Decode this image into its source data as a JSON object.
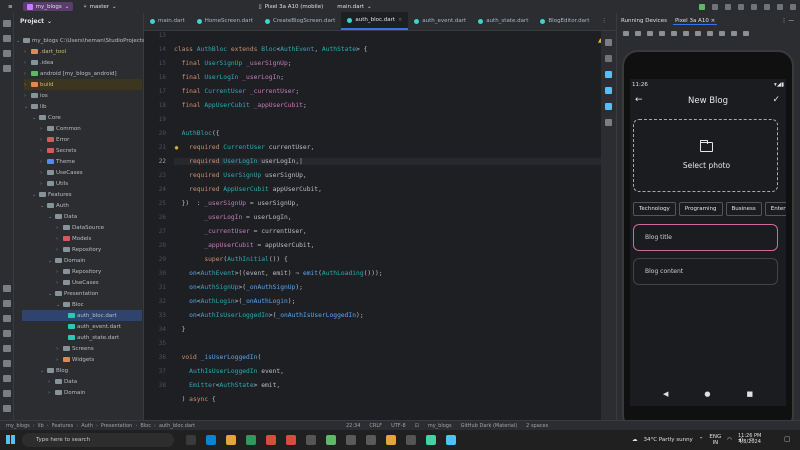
{
  "titlebar": {
    "project": "my_blogs",
    "branch": "master",
    "run_config": "main.dart",
    "device": "Pixel 3a A10 (mobile)"
  },
  "project_panel": {
    "title": "Project",
    "tree": [
      {
        "label": "my_blogs  C:\\Users\\heman\\StudioProjects",
        "kind": "root"
      },
      {
        "label": ".dart_tool",
        "kind": "ylw"
      },
      {
        "label": ".idea",
        "kind": "n"
      },
      {
        "label": "android [my_blogs_android]",
        "kind": "n"
      },
      {
        "label": "build",
        "kind": "ylw"
      },
      {
        "label": "ios",
        "kind": "n"
      },
      {
        "label": "lib",
        "kind": "n"
      },
      {
        "label": "Core",
        "kind": "n"
      },
      {
        "label": "Common",
        "kind": "n"
      },
      {
        "label": "Error",
        "kind": "n"
      },
      {
        "label": "Secrets",
        "kind": "n"
      },
      {
        "label": "Theme",
        "kind": "n"
      },
      {
        "label": "UseCases",
        "kind": "n"
      },
      {
        "label": "Utils",
        "kind": "n"
      },
      {
        "label": "Features",
        "kind": "n"
      },
      {
        "label": "Auth",
        "kind": "n"
      },
      {
        "label": "Data",
        "kind": "n"
      },
      {
        "label": "DataSource",
        "kind": "n"
      },
      {
        "label": "Models",
        "kind": "n"
      },
      {
        "label": "Repository",
        "kind": "n"
      },
      {
        "label": "Domain",
        "kind": "n"
      },
      {
        "label": "Repository",
        "kind": "n"
      },
      {
        "label": "UseCases",
        "kind": "n"
      },
      {
        "label": "Presentation",
        "kind": "n"
      },
      {
        "label": "Bloc",
        "kind": "n"
      },
      {
        "label": "auth_bloc.dart",
        "kind": "file"
      },
      {
        "label": "auth_event.dart",
        "kind": "file"
      },
      {
        "label": "auth_state.dart",
        "kind": "file"
      },
      {
        "label": "Screens",
        "kind": "n"
      },
      {
        "label": "Widgets",
        "kind": "n"
      },
      {
        "label": "Blog",
        "kind": "n"
      },
      {
        "label": "Data",
        "kind": "n"
      },
      {
        "label": "Domain",
        "kind": "n"
      }
    ]
  },
  "tabs": [
    {
      "label": "main.dart",
      "active": false
    },
    {
      "label": "HomeScreen.dart",
      "active": false
    },
    {
      "label": "CreateBlogScreen.dart",
      "active": false
    },
    {
      "label": "auth_bloc.dart",
      "active": true
    },
    {
      "label": "auth_event.dart",
      "active": false
    },
    {
      "label": "auth_state.dart",
      "active": false
    },
    {
      "label": "BlogEditor.dart",
      "active": false
    }
  ],
  "editor": {
    "warning": "▲3",
    "line_numbers": [
      "13",
      "14",
      "15",
      "16",
      "17",
      "18",
      "19",
      "20",
      "21",
      "22",
      "23",
      "24",
      "25",
      "26",
      "27",
      "28",
      "29",
      "30",
      "31",
      "32",
      "33",
      "34",
      "35",
      "36",
      "37",
      "38"
    ],
    "current_line": "22"
  },
  "running_devices": {
    "title": "Running Devices",
    "tab": "Pixel 3a A10"
  },
  "phone": {
    "time": "11:26",
    "title": "New Blog",
    "select_photo": "Select photo",
    "chips": [
      "Technology",
      "Programing",
      "Business",
      "Entert"
    ],
    "blog_title_hint": "Blog title",
    "blog_content_hint": "Blog content"
  },
  "breadcrumb": [
    "my_blogs",
    "lib",
    "Features",
    "Auth",
    "Presentation",
    "Bloc",
    "auth_bloc.dart"
  ],
  "statusbar": {
    "position": "22:34",
    "line_sep": "CRLF",
    "encoding": "UTF-8",
    "project": "my_blogs",
    "theme": "GitHub Dark (Material)",
    "indent": "2 spaces"
  },
  "taskbar": {
    "search_placeholder": "Type here to search",
    "weather": "34°C  Partly sunny",
    "lang": "ENG",
    "region": "IN",
    "time": "11:26 PM",
    "date": "4/8/2024"
  },
  "colors": {
    "accent": "#3574f0",
    "keyword": "#cf8e6d",
    "class": "#2aacb8",
    "field": "#c77dbb",
    "function": "#56a8f5",
    "input_border": "#d16a9c"
  }
}
